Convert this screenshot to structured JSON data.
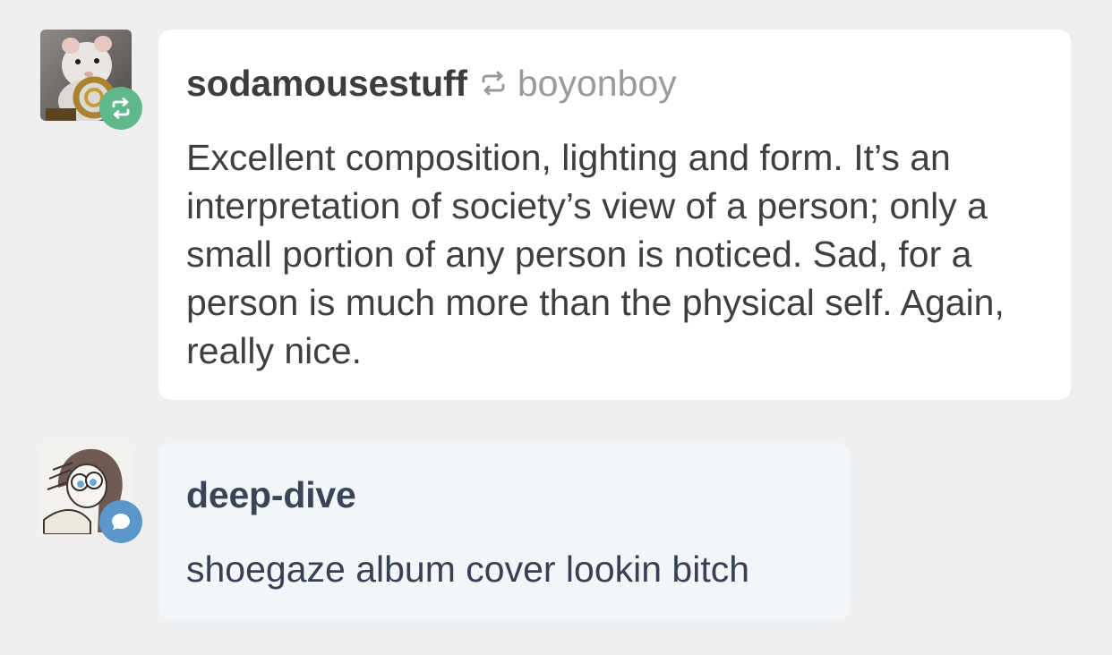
{
  "notes": [
    {
      "type": "reblog",
      "username": "sodamousestuff",
      "reblogged_from": "boyonboy",
      "text": "Excellent composition, lighting and form. It’s an interpretation of society’s view of a person; only a small portion of any person is noticed. Sad, for a person is much more than the physical self. Again, really nice.",
      "badge_icon": "reblog-icon",
      "badge_color": "#5fb98a"
    },
    {
      "type": "reply",
      "username": "deep-dive",
      "text": "shoegaze album cover lookin bitch",
      "badge_icon": "speech-bubble-icon",
      "badge_color": "#5b97c9"
    }
  ]
}
